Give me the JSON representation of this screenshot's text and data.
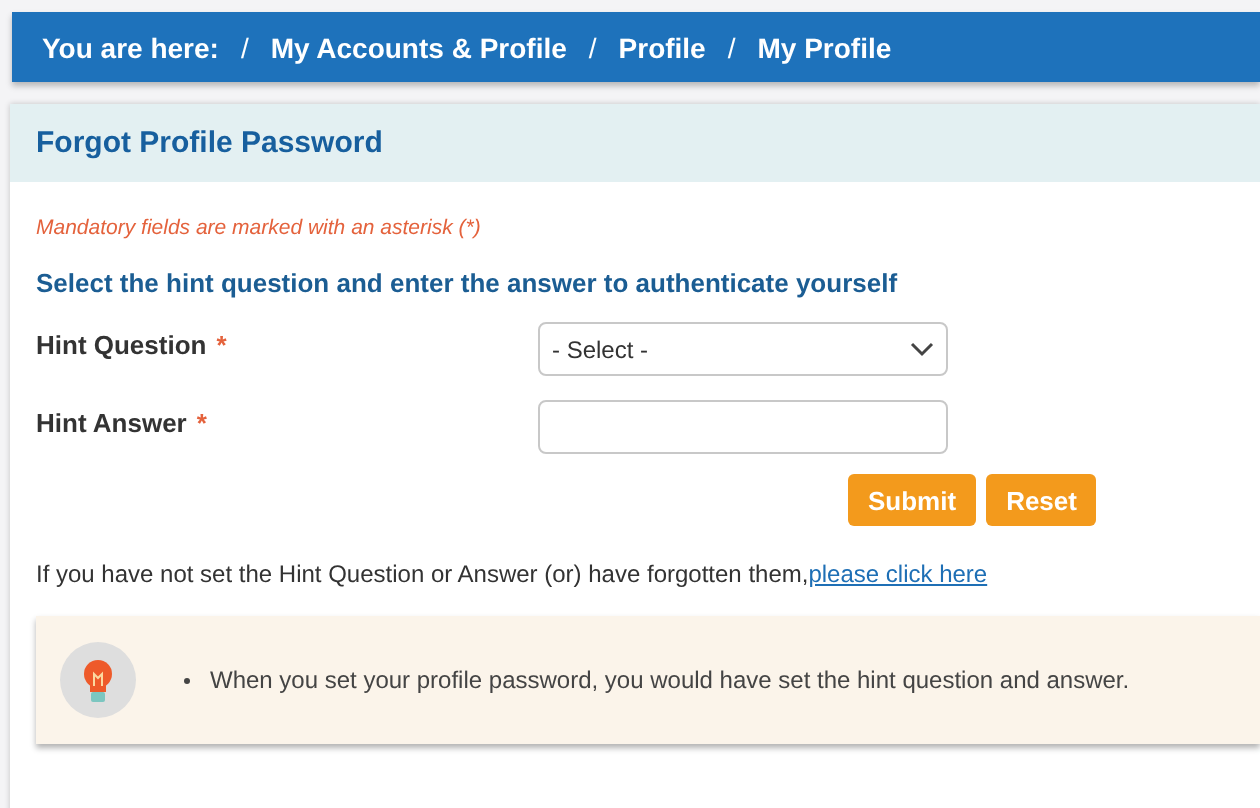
{
  "breadcrumb": {
    "label": "You are here:",
    "items": [
      {
        "separator": "/",
        "label": "My Accounts & Profile"
      },
      {
        "separator": "/",
        "label": "Profile"
      },
      {
        "separator": "/",
        "label": "My Profile"
      }
    ]
  },
  "panel": {
    "title": "Forgot Profile Password",
    "mandatory_note": "Mandatory fields are marked with an asterisk (*)",
    "instruction": "Select the hint question and enter the answer to authenticate yourself",
    "fields": [
      {
        "kind": "select",
        "label": "Hint Question",
        "asterisk": "*",
        "value": "- Select -"
      },
      {
        "kind": "text",
        "label": "Hint Answer",
        "asterisk": "*"
      }
    ],
    "buttons": [
      "Submit",
      "Reset"
    ],
    "help_text": "If you have not set the Hint Question or Answer (or) have forgotten them,",
    "help_link": "please click here",
    "tips": [
      "When you set your profile password, you would have set the hint question and answer."
    ]
  }
}
